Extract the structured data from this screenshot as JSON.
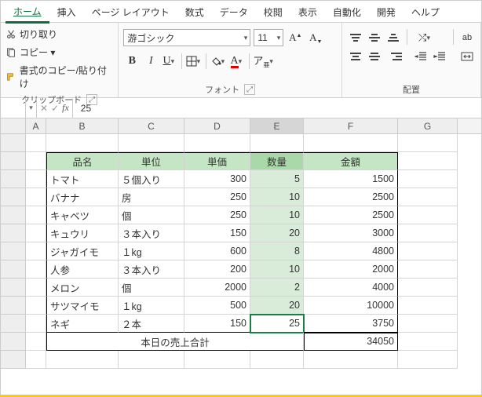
{
  "tabs": [
    "ホーム",
    "挿入",
    "ページ レイアウト",
    "数式",
    "データ",
    "校閲",
    "表示",
    "自動化",
    "開発",
    "ヘルプ"
  ],
  "ribbon": {
    "clipboard": {
      "cut": "切り取り",
      "copy": "コピー ▾",
      "paste_format": "書式のコピー/貼り付け",
      "label": "クリップボード"
    },
    "font": {
      "name": "游ゴシック",
      "size": "11",
      "label": "フォント"
    },
    "alignment": {
      "label": "配置"
    }
  },
  "formula": {
    "name_box": "",
    "value": "25"
  },
  "columns": [
    "A",
    "B",
    "C",
    "D",
    "E",
    "F",
    "G"
  ],
  "headers": {
    "B": "品名",
    "C": "単位",
    "D": "単価",
    "E": "数量",
    "F": "金額"
  },
  "rows": [
    {
      "B": "トマト",
      "C": "５個入り",
      "D": "300",
      "E": "5",
      "F": "1500"
    },
    {
      "B": "バナナ",
      "C": "房",
      "D": "250",
      "E": "10",
      "F": "2500"
    },
    {
      "B": "キャベツ",
      "C": "個",
      "D": "250",
      "E": "10",
      "F": "2500"
    },
    {
      "B": "キュウリ",
      "C": "３本入り",
      "D": "150",
      "E": "20",
      "F": "3000"
    },
    {
      "B": "ジャガイモ",
      "C": "１kg",
      "D": "600",
      "E": "8",
      "F": "4800"
    },
    {
      "B": "人参",
      "C": "３本入り",
      "D": "200",
      "E": "10",
      "F": "2000"
    },
    {
      "B": "メロン",
      "C": "個",
      "D": "2000",
      "E": "2",
      "F": "4000"
    },
    {
      "B": "サツマイモ",
      "C": "１kg",
      "D": "500",
      "E": "20",
      "F": "10000"
    },
    {
      "B": "ネギ",
      "C": "２本",
      "D": "150",
      "E": "25",
      "F": "3750"
    }
  ],
  "footer": {
    "label": "本日の売上合計",
    "total": "34050"
  }
}
